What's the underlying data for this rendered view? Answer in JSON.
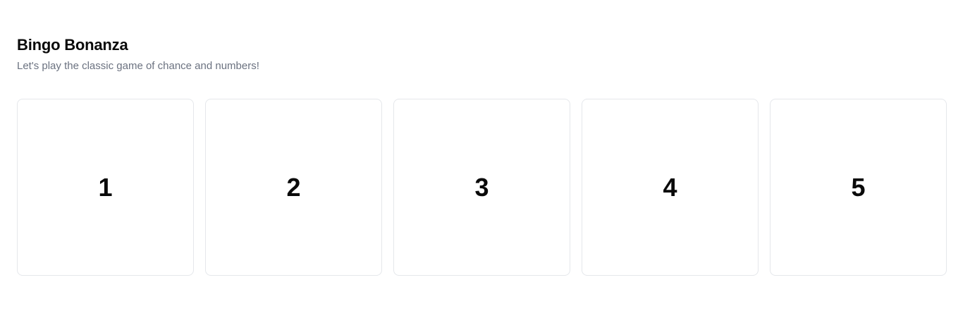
{
  "header": {
    "title": "Bingo Bonanza",
    "subtitle": "Let's play the classic game of chance and numbers!"
  },
  "board": {
    "cells": [
      {
        "number": "1"
      },
      {
        "number": "2"
      },
      {
        "number": "3"
      },
      {
        "number": "4"
      },
      {
        "number": "5"
      }
    ]
  },
  "colors": {
    "text": "#0a0a0a",
    "muted": "#6b7280",
    "border": "#e5e7eb",
    "background": "#ffffff"
  }
}
